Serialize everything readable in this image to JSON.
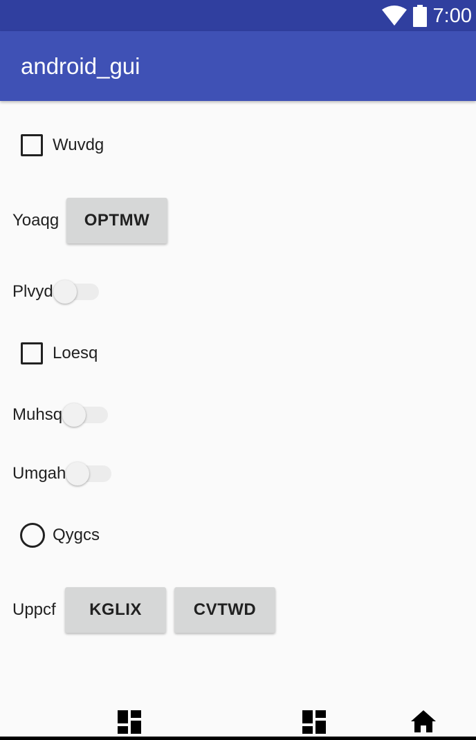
{
  "status_bar": {
    "time": "7:00",
    "icons": [
      "wifi-icon",
      "battery-icon"
    ]
  },
  "app_bar": {
    "title": "android_gui"
  },
  "colors": {
    "primary": "#3f51b5",
    "primary_dark": "#303f9f",
    "button": "#d6d7d7",
    "background": "#fafafa"
  },
  "form": {
    "checkbox_1": {
      "label": "Wuvdg",
      "checked": false
    },
    "row_yoaqg": {
      "label": "Yoaqg",
      "button": "OPTMW"
    },
    "switch_1": {
      "label": "Plvyd",
      "on": false
    },
    "checkbox_2": {
      "label": "Loesq",
      "checked": false
    },
    "switch_2": {
      "label": "Muhsq",
      "on": false
    },
    "switch_3": {
      "label": "Umgah",
      "on": false
    },
    "radio_1": {
      "label": "Qygcs",
      "selected": false
    },
    "row_uppcf": {
      "label": "Uppcf",
      "buttons": [
        "KGLIX",
        "CVTWD"
      ]
    }
  },
  "nav_bar": {
    "icons": [
      "dashboard-icon",
      "dashboard-icon",
      "home-icon"
    ]
  }
}
